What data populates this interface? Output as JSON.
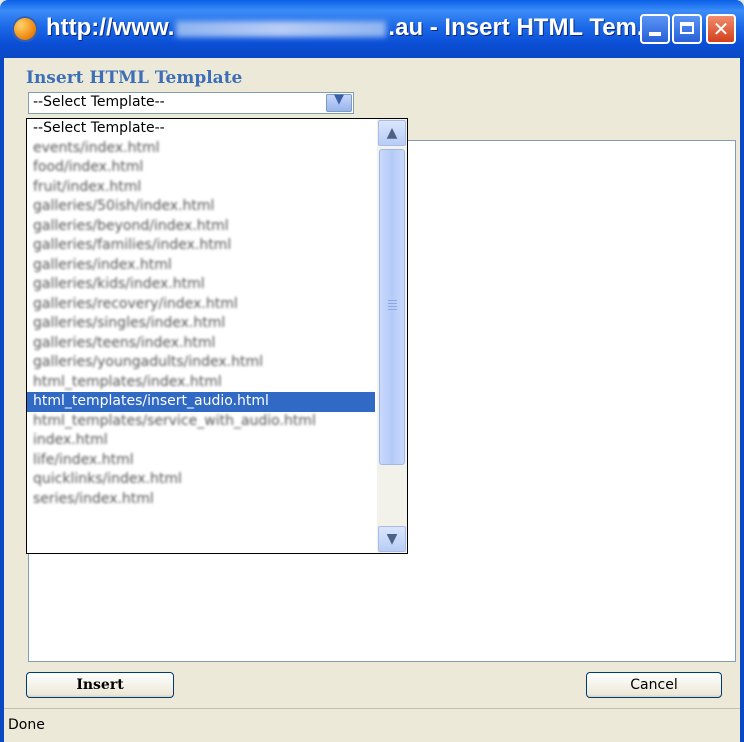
{
  "window": {
    "title_prefix": "http://www.",
    "title_suffix": ".au - Insert HTML Tem...",
    "app_icon": "firefox-icon",
    "minimize_icon": "minimize-icon",
    "maximize_icon": "maximize-icon",
    "close_icon": "close-icon",
    "close_glyph": "✕"
  },
  "dialog": {
    "heading": "Insert HTML Template",
    "select": {
      "value": "--Select Template--",
      "arrow_glyph": "▼"
    },
    "dropdown": {
      "items": [
        "--Select Template--",
        "events/index.html",
        "food/index.html",
        "fruit/index.html",
        "galleries/50ish/index.html",
        "galleries/beyond/index.html",
        "galleries/families/index.html",
        "galleries/index.html",
        "galleries/kids/index.html",
        "galleries/recovery/index.html",
        "galleries/singles/index.html",
        "galleries/teens/index.html",
        "galleries/youngadults/index.html",
        "html_templates/index.html",
        "html_templates/insert_audio.html",
        "html_templates/service_with_audio.html",
        "index.html",
        "life/index.html",
        "quicklinks/index.html",
        "series/index.html"
      ],
      "selected_index": 14,
      "scroll_up_glyph": "▲",
      "scroll_down_glyph": "▼"
    },
    "buttons": {
      "insert": "Insert",
      "cancel": "Cancel"
    }
  },
  "status": {
    "text": "Done"
  }
}
